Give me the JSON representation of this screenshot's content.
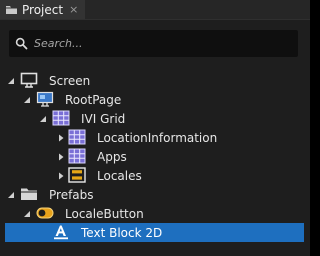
{
  "tab": {
    "label": "Project",
    "close_glyph": "×",
    "icon": "project-folder-icon"
  },
  "search": {
    "placeholder": "Search..."
  },
  "tree": [
    {
      "label": "Screen",
      "icon": "monitor-icon",
      "expanded": true
    },
    {
      "label": "RootPage",
      "icon": "page-icon",
      "expanded": true
    },
    {
      "label": "IVI Grid",
      "icon": "grid-icon",
      "expanded": true
    },
    {
      "label": "LocationInformation",
      "icon": "grid-icon",
      "expanded": false
    },
    {
      "label": "Apps",
      "icon": "grid-icon",
      "expanded": false
    },
    {
      "label": "Locales",
      "icon": "stack-panel-icon",
      "expanded": false
    },
    {
      "label": "Prefabs",
      "icon": "folder-icon",
      "expanded": true
    },
    {
      "label": "LocaleButton",
      "icon": "toggle-button-icon",
      "expanded": true
    },
    {
      "label": "Text Block 2D",
      "icon": "text-block-icon",
      "selected": true
    }
  ],
  "colors": {
    "selection": "#1e6fbf",
    "background": "#1e1e1e",
    "grid_icon": "#7a6fd6"
  }
}
